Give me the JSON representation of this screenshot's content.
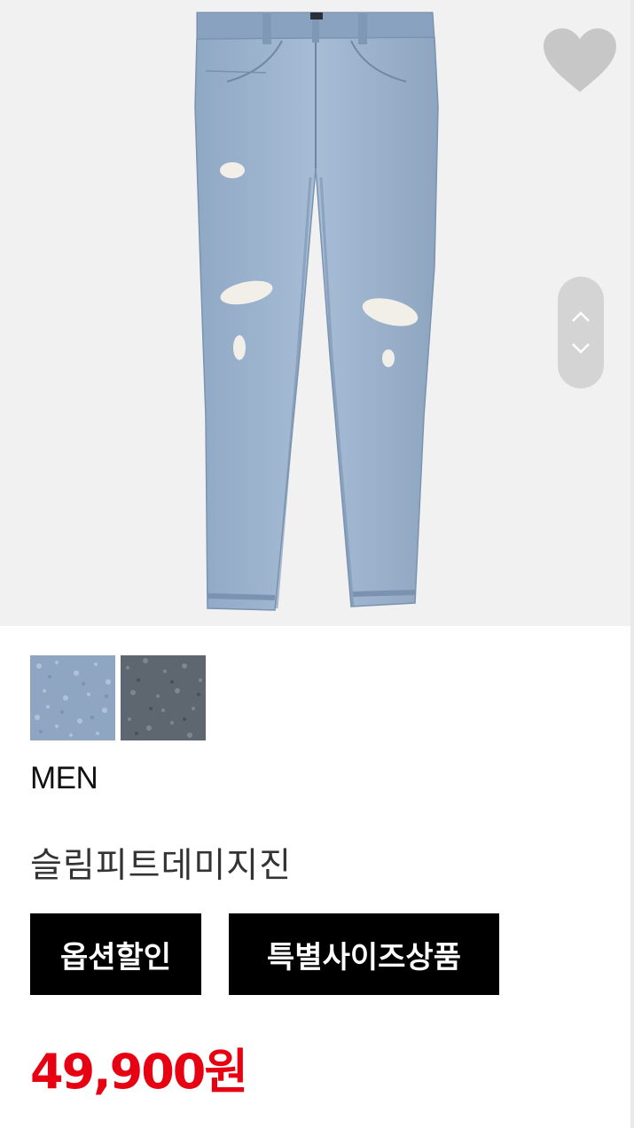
{
  "product": {
    "gender": "MEN",
    "name": "슬림피트데미지진",
    "price": "49,900원",
    "tags": [
      "옵션할인",
      "특별사이즈상품"
    ]
  },
  "swatches": [
    {
      "name": "light-blue-denim",
      "color": "#8ea6c2"
    },
    {
      "name": "dark-gray-denim",
      "color": "#5e6770"
    }
  ],
  "icons": {
    "wishlist": "heart-icon",
    "image_up": "chevron-up-icon",
    "image_down": "chevron-down-icon"
  },
  "colors": {
    "price": "#e60012",
    "tag_bg": "#000000",
    "tag_text": "#ffffff",
    "hero_bg": "#f1f1f1",
    "control_gray": "#d4d4d4"
  }
}
